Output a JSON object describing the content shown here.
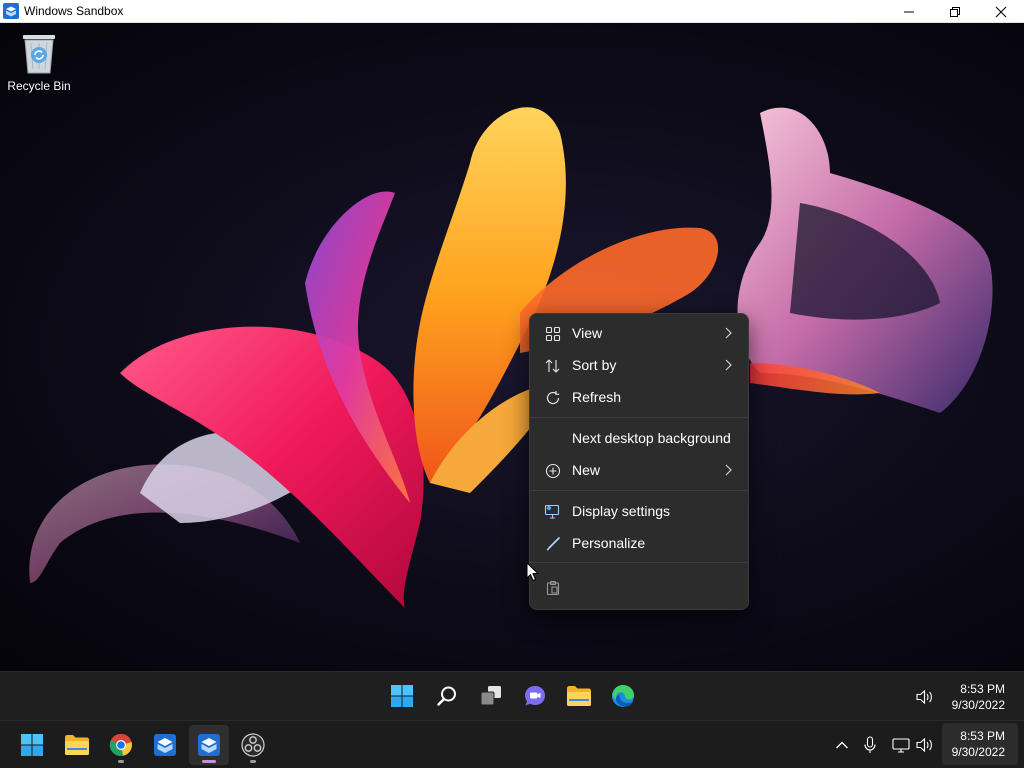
{
  "window": {
    "title": "Windows Sandbox",
    "controls": [
      "minimize-icon",
      "restore-icon",
      "close-icon"
    ]
  },
  "desktop": {
    "icons": [
      {
        "label": "Recycle Bin",
        "icon": "recycle-bin-icon"
      }
    ]
  },
  "context_menu": {
    "items": [
      {
        "label": "View",
        "icon": "view-grid-icon",
        "submenu": true
      },
      {
        "label": "Sort by",
        "icon": "sort-icon",
        "submenu": true
      },
      {
        "label": "Refresh",
        "icon": "refresh-icon",
        "submenu": false
      },
      {
        "label": "Next desktop background",
        "icon": "",
        "submenu": false
      },
      {
        "label": "New",
        "icon": "new-plus-icon",
        "submenu": true
      },
      {
        "label": "Display settings",
        "icon": "display-settings-icon",
        "submenu": false
      },
      {
        "label": "Personalize",
        "icon": "personalize-brush-icon",
        "submenu": false
      }
    ],
    "bottom_actions": [
      "paste-icon"
    ]
  },
  "sandbox_taskbar": {
    "apps": [
      "start-icon",
      "search-icon",
      "task-view-icon",
      "chat-icon",
      "file-explorer-icon",
      "edge-icon"
    ],
    "clock": {
      "time": "8:53 PM",
      "date": "9/30/2022"
    }
  },
  "host_taskbar": {
    "apps": [
      "start-icon",
      "file-explorer-icon",
      "chrome-icon",
      "windows-sandbox-icon",
      "windows-sandbox-active-icon",
      "obs-icon"
    ],
    "tray": [
      "chevron-up-icon",
      "microphone-icon",
      "network-icon",
      "volume-icon"
    ],
    "clock": {
      "time": "8:53 PM",
      "date": "9/30/2022"
    }
  },
  "colors": {
    "menu_bg": "#2c2c2c",
    "taskbar_bg": "#1f1f1f",
    "accent": "#0078d4"
  }
}
